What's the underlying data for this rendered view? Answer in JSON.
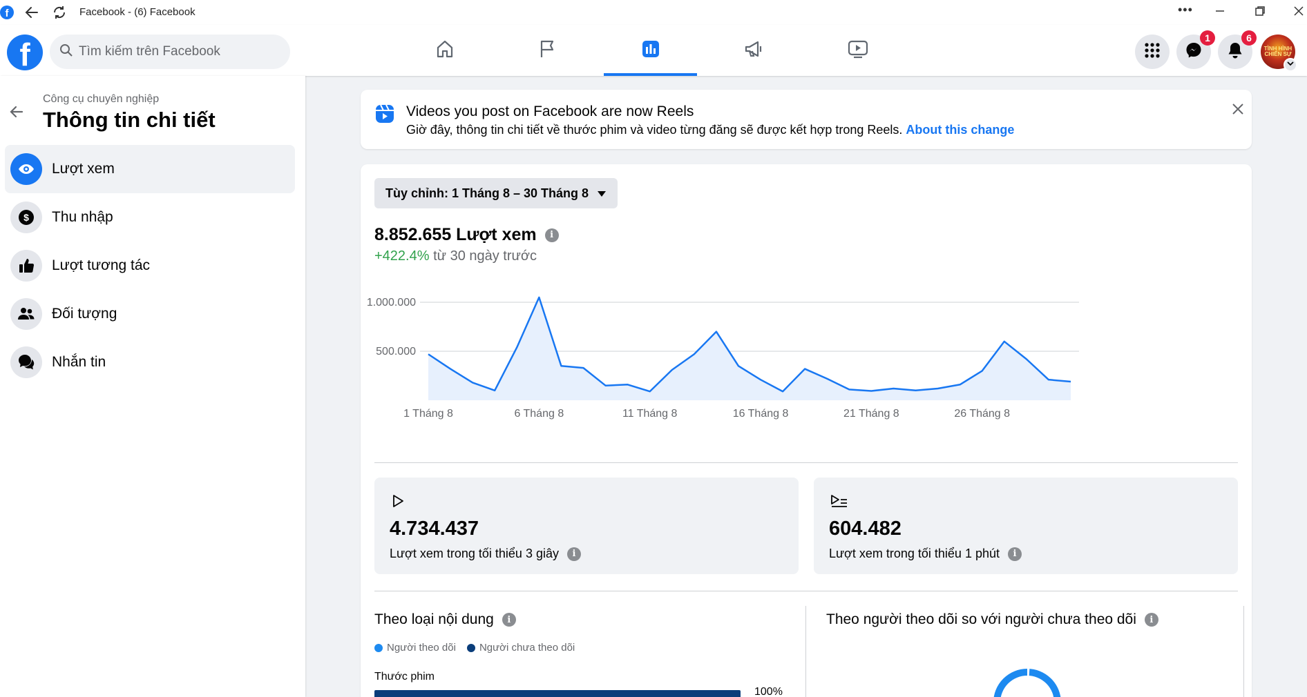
{
  "window": {
    "title": "Facebook - (6) Facebook"
  },
  "topnav": {
    "search_placeholder": "Tìm kiếm trên Facebook",
    "tabs": [
      "home",
      "pages",
      "insights",
      "ads",
      "watch"
    ],
    "active_tab": "insights",
    "messenger_badge": "1",
    "notifications_badge": "6",
    "avatar_text": "TÌNH HÌNH CHIẾN SỰ"
  },
  "sidebar": {
    "breadcrumb": "Công cụ chuyên nghiệp",
    "title": "Thông tin chi tiết",
    "items": [
      {
        "label": "Lượt xem",
        "icon": "eye-icon",
        "active": true
      },
      {
        "label": "Thu nhập",
        "icon": "dollar-icon",
        "active": false
      },
      {
        "label": "Lượt tương tác",
        "icon": "thumbs-up-icon",
        "active": false
      },
      {
        "label": "Đối tượng",
        "icon": "people-icon",
        "active": false
      },
      {
        "label": "Nhắn tin",
        "icon": "chat-icon",
        "active": false
      }
    ]
  },
  "banner": {
    "title": "Videos you post on Facebook are now Reels",
    "text": "Giờ đây, thông tin chi tiết về thước phim và video từng đăng sẽ được kết hợp trong Reels.",
    "link": "About this change"
  },
  "overview": {
    "range_label": "Tùy chỉnh: 1 Tháng 8 – 30 Tháng 8",
    "total": "8.852.655 Lượt xem",
    "delta_value": "+422.4%",
    "delta_text": "từ 30 ngày trước"
  },
  "chart_data": {
    "type": "area",
    "x": [
      1,
      2,
      3,
      4,
      5,
      6,
      7,
      8,
      9,
      10,
      11,
      12,
      13,
      14,
      15,
      16,
      17,
      18,
      19,
      20,
      21,
      22,
      23,
      24,
      25,
      26,
      27,
      28,
      29,
      30
    ],
    "values": [
      470000,
      320000,
      180000,
      100000,
      540000,
      1050000,
      350000,
      330000,
      150000,
      160000,
      90000,
      310000,
      470000,
      700000,
      350000,
      210000,
      90000,
      320000,
      220000,
      110000,
      95000,
      120000,
      100000,
      120000,
      160000,
      300000,
      600000,
      420000,
      210000,
      190000
    ],
    "xticks": [
      "1 Tháng 8",
      "6 Tháng 8",
      "11 Tháng 8",
      "16 Tháng 8",
      "21 Tháng 8",
      "26 Tháng 8"
    ],
    "xtick_days": [
      1,
      6,
      11,
      16,
      21,
      26
    ],
    "yticks": [
      "500.000",
      "1.000.000"
    ],
    "ytick_values": [
      500000,
      1000000
    ],
    "ylim": [
      0,
      1000000
    ],
    "grid": true,
    "color": "#1877f2",
    "fill": "#e7f0fd"
  },
  "stats": [
    {
      "value": "4.734.437",
      "label": "Lượt xem trong tối thiểu 3 giây",
      "icon": "play-icon"
    },
    {
      "value": "604.482",
      "label": "Lượt xem trong tối thiểu 1 phút",
      "icon": "play-list-icon"
    }
  ],
  "content_type": {
    "title": "Theo loại nội dung",
    "legend": [
      {
        "label": "Người theo dõi",
        "color": "#1d8af0"
      },
      {
        "label": "Người chưa theo dõi",
        "color": "#0a3d7a"
      }
    ],
    "bar_label": "Thước phim",
    "bar_pct": "100%",
    "bar_fraction": 1.0
  },
  "followers": {
    "title": "Theo người theo dõi so với người chưa theo dõi"
  }
}
